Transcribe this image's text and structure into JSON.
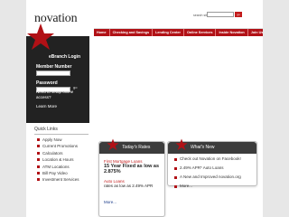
{
  "header": {
    "logo_text": "novation",
    "search_label": "search site",
    "search_placeholder": "",
    "search_button": "go"
  },
  "nav": {
    "items": [
      "Home",
      "Checking and Savings",
      "Lending Center",
      "Online Services",
      "Inside Novation",
      "Join Us"
    ]
  },
  "login": {
    "title": "eBranch Login",
    "member_number_label": "Member Number",
    "password_label": "Password",
    "go_label": "go",
    "help_text": "Need to setup online access?",
    "learn_more": "Learn More"
  },
  "quick_links": {
    "title": "Quick Links",
    "items": [
      "Apply Now",
      "Current Promotions",
      "Calculators",
      "Location & Hours",
      "ATM Locations",
      "Bill Pay Video",
      "Investment Services"
    ]
  },
  "rates_box": {
    "title_prefix": "Today's",
    "title_suffix": "Rates",
    "mortgage_title": "First Mortgage Loans",
    "mortgage_line1": "15 Year Fixed as low as",
    "mortgage_rate": "2.875%",
    "auto_title": "Auto Loans",
    "auto_line": "rates as low as 2.49% APR",
    "more": "More..."
  },
  "news_box": {
    "title_prefix": "What's",
    "title_suffix": "New",
    "items": [
      "Check out Novation on Facebook!",
      "2.49% APR* Auto Loans",
      "A New and Improved novation.org"
    ],
    "more": "More..."
  }
}
